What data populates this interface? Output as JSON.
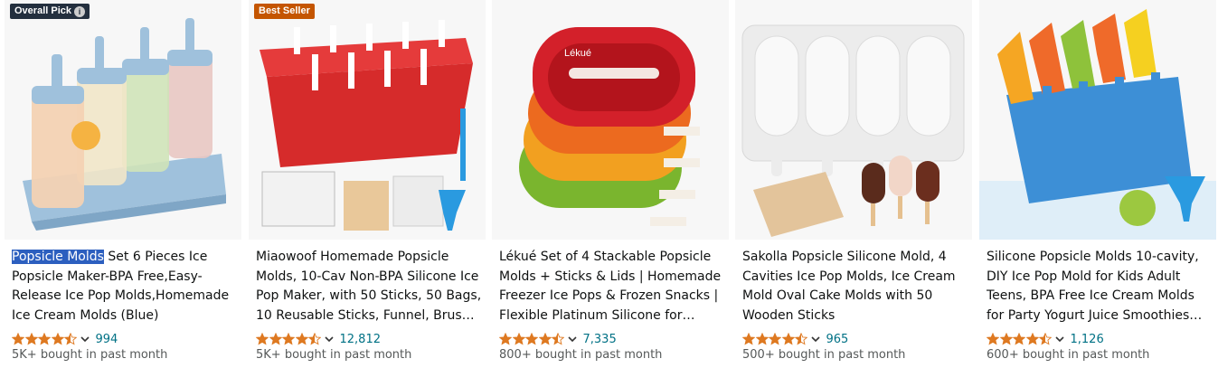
{
  "colors": {
    "highlight": "#2c5fbf",
    "star": "#de7921",
    "link": "#007185",
    "muted": "#565959"
  },
  "products": [
    {
      "badge": "Overall Pick",
      "badge_icon": "info-icon",
      "title_highlight": "Popsicle Molds",
      "title_rest": " Set 6 Pieces Ice Popsicle Maker-BPA Free,Easy-Release Ice Pop Molds,Homemade Ice Cream Molds (Blue)",
      "rating": 4.5,
      "rating_count": "994",
      "bought": "5K+ bought in past month",
      "image": "blue-popsicle-mold-set"
    },
    {
      "badge": "Best Seller",
      "title_highlight": "",
      "title_rest": "Miaowoof Homemade Popsicle Molds, 10-Cav Non-BPA Silicone Ice Pop Maker, with 50 Sticks, 50 Bags, 10 Reusable Sticks, Funnel, Brush and...",
      "rating": 4.5,
      "rating_count": "12,812",
      "bought": "5K+ bought in past month",
      "image": "red-10-cavity-mold"
    },
    {
      "badge": "",
      "title_highlight": "",
      "title_rest": "Lékué Set of 4 Stackable Popsicle Molds + Sticks & Lids | Homemade Freezer Ice Pops & Frozen Snacks | Flexible Platinum Silicone for Easy...",
      "rating": 4.5,
      "rating_count": "7,335",
      "bought": "800+ bought in past month",
      "image": "stackable-colored-molds",
      "logo_text": "Lékué"
    },
    {
      "badge": "",
      "title_highlight": "",
      "title_rest": "Sakolla Popsicle Silicone Mold, 4 Cavities Ice Pop Molds, Ice Cream Mold Oval Cake Molds with 50 Wooden Sticks",
      "rating": 4.5,
      "rating_count": "965",
      "bought": "500+ bought in past month",
      "image": "white-4-cavity-mold"
    },
    {
      "badge": "",
      "title_highlight": "",
      "title_rest": "Silicone Popsicle Molds 10-cavity, DIY Ice Pop Mold for Kids Adult Teens, BPA Free Ice Cream Molds for Party Yogurt Juice Smoothies Sticks",
      "rating": 4.5,
      "rating_count": "1,126",
      "bought": "600+ bought in past month",
      "image": "blue-10-cavity-mold"
    }
  ]
}
